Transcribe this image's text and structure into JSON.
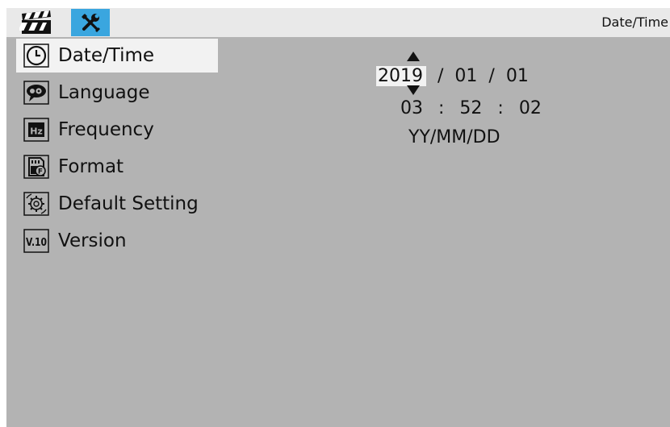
{
  "topbar": {
    "tabs": [
      {
        "name": "video",
        "icon": "clapperboard-icon",
        "selected": false
      },
      {
        "name": "settings",
        "icon": "tools-icon",
        "selected": true
      }
    ],
    "title": "Date/Time"
  },
  "menu": {
    "items": [
      {
        "label": "Date/Time",
        "icon": "clock-icon",
        "selected": true
      },
      {
        "label": "Language",
        "icon": "speech-bubble-icon",
        "selected": false
      },
      {
        "label": "Frequency",
        "icon": "hz-icon",
        "selected": false
      },
      {
        "label": "Format",
        "icon": "sd-card-format-icon",
        "selected": false
      },
      {
        "label": "Default Setting",
        "icon": "gear-reset-icon",
        "selected": false
      },
      {
        "label": "Version",
        "icon": "version-icon",
        "selected": false
      }
    ]
  },
  "datetime": {
    "year": "2019",
    "month": "01",
    "day": "01",
    "date_separator": "/",
    "hour": "03",
    "minute": "52",
    "second": "02",
    "time_separator": ":",
    "format": "YY/MM/DD"
  },
  "icons": {
    "version_text": "V.10",
    "hz_text": "Hz"
  },
  "colors": {
    "screen_bg": "#b3b3b3",
    "topbar_bg": "#e9e9e9",
    "selected_tab_bg": "#3aa6df",
    "highlight_bg": "#f2f2f2",
    "text": "#111111"
  }
}
